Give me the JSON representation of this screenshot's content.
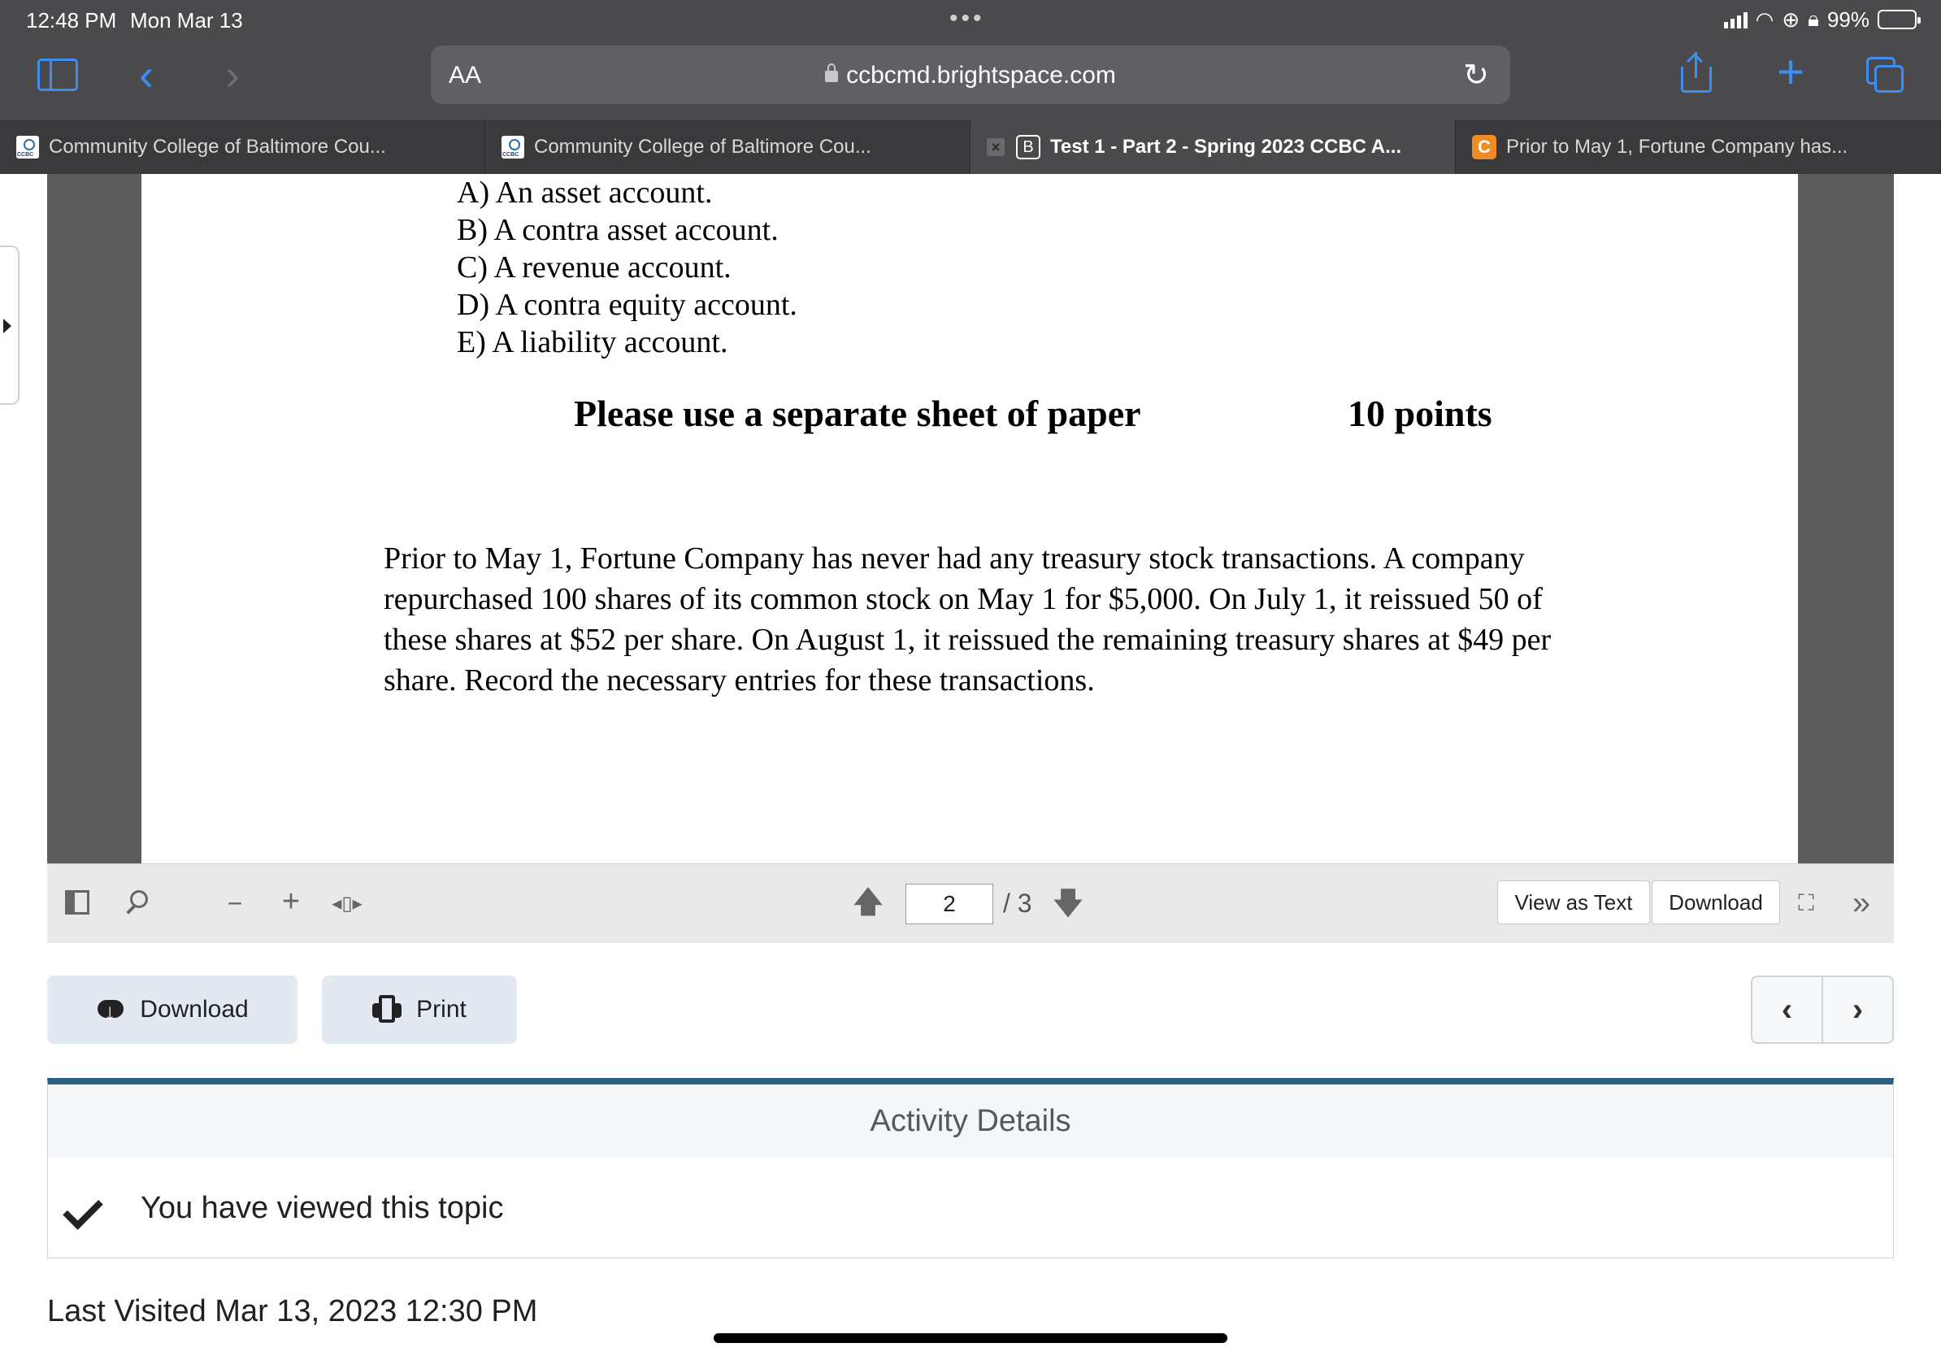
{
  "status_bar": {
    "time": "12:48 PM",
    "date": "Mon Mar 13",
    "battery": "99%",
    "battery_level": 0.99
  },
  "browser": {
    "text_size_label": "AA",
    "url": "ccbcmd.brightspace.com",
    "accent_color": "#3d8ef0",
    "tabs": [
      {
        "label": "Community College of Baltimore Cou...",
        "favicon": "ccbc-logo-icon",
        "active": false
      },
      {
        "label": "Community College of Baltimore Cou...",
        "favicon": "ccbc-logo-icon",
        "active": false
      },
      {
        "label": "Test 1 - Part 2 - Spring 2023 CCBC A...",
        "favicon": "b-badge-icon",
        "favicon_letter": "B",
        "close_glyph": "×",
        "active": true
      },
      {
        "label": "Prior to May 1, Fortune Company has...",
        "favicon": "c-badge-icon",
        "favicon_letter": "C",
        "active": false
      }
    ]
  },
  "document": {
    "choices": [
      "A) An asset account.",
      "B) A contra asset account.",
      "C) A revenue account.",
      "D) A contra equity account.",
      "E) A liability account."
    ],
    "instruction": "Please use a separate sheet of paper",
    "points": "10 points",
    "question_lines": [
      "Prior to May 1, Fortune Company has never had any treasury stock transactions. A company",
      "repurchased 100 shares of its common stock on May 1 for $5,000. On July 1, it reissued 50 of",
      "these shares at $52 per share. On August 1, it reissued the remaining treasury shares at $49 per",
      "share.  Record the necessary entries for these transactions."
    ]
  },
  "pdf_toolbar": {
    "current_page": "2",
    "page_total": "/ 3",
    "view_as_text_label": "View as Text",
    "download_label": "Download"
  },
  "actions": {
    "download_label": "Download",
    "print_label": "Print"
  },
  "activity": {
    "heading": "Activity Details",
    "status": "You have viewed this topic",
    "header_color": "#2a6082"
  },
  "last_visited": "Last Visited Mar 13, 2023 12:30 PM"
}
